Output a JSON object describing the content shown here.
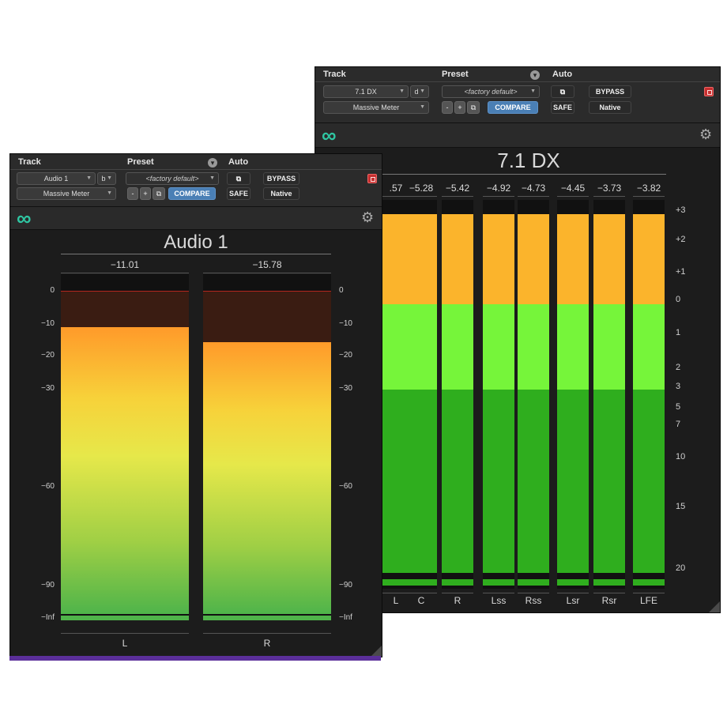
{
  "window_a": {
    "header": {
      "track_label": "Track",
      "preset_label": "Preset",
      "auto_label": "Auto",
      "track_name": "Audio 1",
      "track_slot": "b",
      "plugin_name": "Massive Meter",
      "preset_value": "<factory default>",
      "minus": "-",
      "plus": "+",
      "compare_label": "COMPARE",
      "bypass_label": "BYPASS",
      "safe_label": "SAFE",
      "native_label": "Native"
    },
    "meter_title": "Audio 1",
    "channels": [
      {
        "name": "L",
        "peak": "−11.01",
        "level_db": -11.01
      },
      {
        "name": "R",
        "peak": "−15.78",
        "level_db": -15.78
      }
    ],
    "scale": [
      "0",
      "−10",
      "−20",
      "−30",
      "−60",
      "−90",
      "−Inf"
    ]
  },
  "window_b": {
    "header": {
      "track_label": "Track",
      "preset_label": "Preset",
      "auto_label": "Auto",
      "track_name": "7.1 DX",
      "track_slot": "d",
      "plugin_name": "Massive Meter",
      "preset_value": "<factory default>",
      "minus": "-",
      "plus": "+",
      "compare_label": "COMPARE",
      "bypass_label": "BYPASS",
      "safe_label": "SAFE",
      "native_label": "Native"
    },
    "meter_title": "7.1 DX",
    "channels": [
      {
        "name": "L",
        "peak": ".57"
      },
      {
        "name": "C",
        "peak": "−5.28"
      },
      {
        "name": "R",
        "peak": "−5.42"
      },
      {
        "name": "Lss",
        "peak": "−4.92"
      },
      {
        "name": "Rss",
        "peak": "−4.73"
      },
      {
        "name": "Lsr",
        "peak": "−4.45"
      },
      {
        "name": "Rsr",
        "peak": "−3.73"
      },
      {
        "name": "LFE",
        "peak": "−3.82"
      }
    ],
    "scale": [
      "+3",
      "+2",
      "+1",
      "0",
      "1",
      "2",
      "3",
      "5",
      "7",
      "10",
      "15",
      "20"
    ]
  },
  "colors": {
    "accent_logo": "#2fc6a2",
    "compare_blue": "#4a7fb5",
    "bypass_red": "#c62f2f",
    "meter_orange": "#fbb42c",
    "meter_lime": "#76f53a",
    "meter_green": "#2fae1e"
  },
  "icons": [
    "link-logo-icon",
    "gear-icon",
    "dropdown-icon",
    "copy-icon",
    "stop-icon"
  ]
}
